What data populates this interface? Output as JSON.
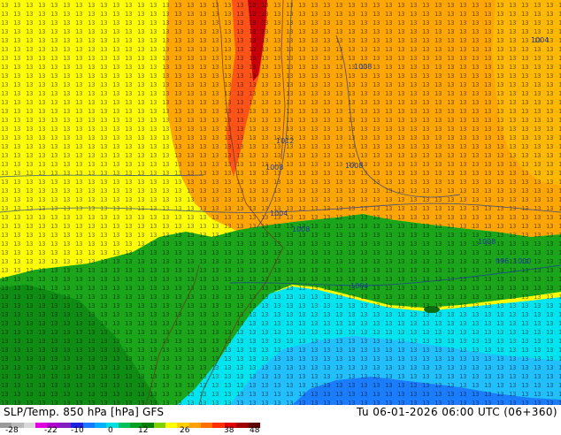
{
  "title": "SLP/Temp. 850 hPa [hPa] GFS",
  "datetime": "Tu 06-01-2026 06:00 UTC (06+360)",
  "colorbar": {
    "ticks": [
      "-28",
      "-22",
      "-10",
      "0",
      "12",
      "26",
      "38",
      "48"
    ],
    "colors": [
      "#9a9a9a",
      "#b9b9b9",
      "#d8d8d8",
      "#e000e0",
      "#b000d0",
      "#8020c0",
      "#2020e0",
      "#1878ff",
      "#00b0ff",
      "#00e0e0",
      "#00c060",
      "#00a020",
      "#008000",
      "#80d000",
      "#ffff00",
      "#ffd000",
      "#ffa000",
      "#ff7000",
      "#ff3000",
      "#e00000",
      "#a00000",
      "#600000"
    ]
  },
  "map": {
    "colors": {
      "warm_orange": "#ffa500",
      "warm_yellow": "#ffd700",
      "yellow": "#ffff00",
      "green": "#1aa51a",
      "dark_green": "#0e8c14",
      "cyan": "#00e4f0",
      "light_blue": "#22bfff",
      "blue": "#1a7cff",
      "red": "#e0120a",
      "dark_red": "#a8000a"
    },
    "pressure_labels": [
      "1004",
      "1008",
      "1012",
      "1008",
      "1008",
      "1004",
      "1008",
      "996",
      "1000",
      "1004",
      "1008"
    ]
  }
}
